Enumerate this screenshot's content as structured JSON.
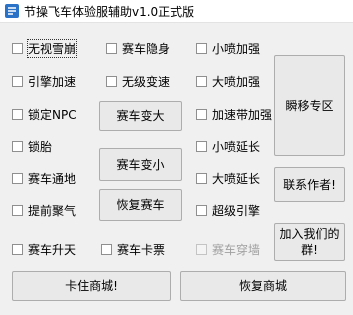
{
  "window": {
    "title": "节操飞车体验服辅助v1.0正式版"
  },
  "checkboxes": {
    "c1_1": "无视雪崩",
    "c1_2": "引擎加速",
    "c1_3": "锁定NPC",
    "c1_4": "锁胎",
    "c1_5": "赛车通地",
    "c1_6": "提前聚气",
    "c1_7": "赛车升天",
    "c2_1": "赛车隐身",
    "c2_2": "无级变速",
    "c2_7": "赛车卡票",
    "c3_1": "小喷加强",
    "c3_2": "大喷加强",
    "c3_3": "加速带加强",
    "c3_4": "小喷延长",
    "c3_5": "大喷延长",
    "c3_6": "超级引擎",
    "c3_7": "赛车穿墙"
  },
  "buttons": {
    "enlarge": "赛车变大",
    "shrink": "赛车变小",
    "restore_car": "恢复赛车",
    "teleport": "瞬移专区",
    "contact": "联系作者!",
    "join_group": "加入我们的群!",
    "stuck_mall": "卡住商城!",
    "restore_mall": "恢复商城"
  }
}
